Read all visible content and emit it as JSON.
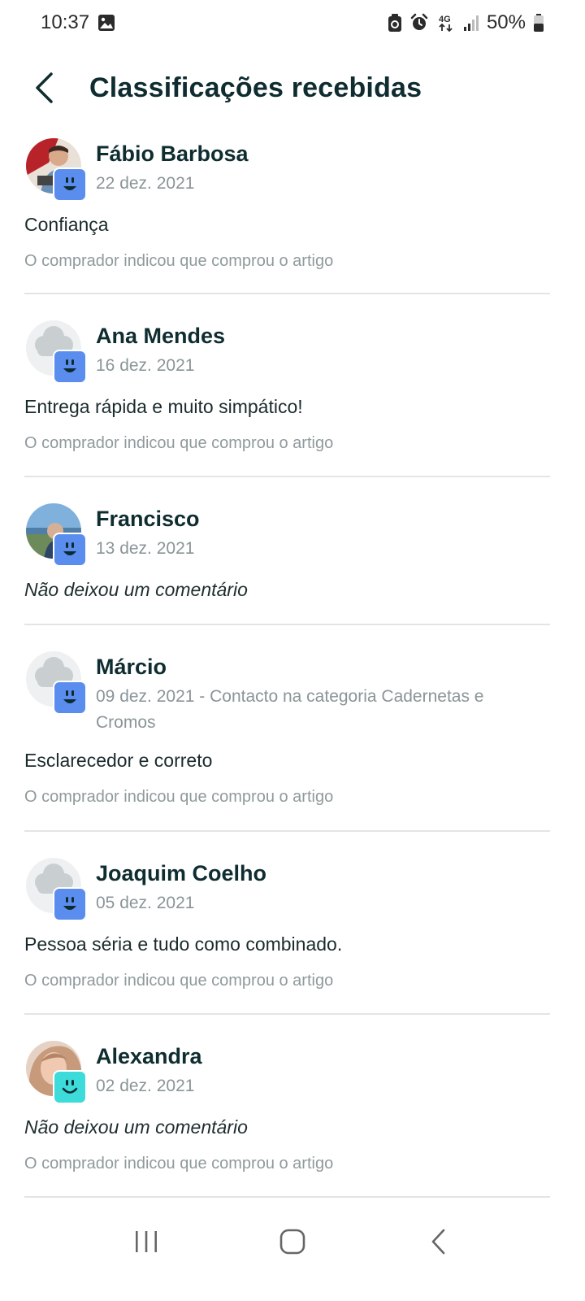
{
  "status_bar": {
    "time": "10:37",
    "battery": "50%",
    "network": "4G",
    "icons": [
      "gallery-icon",
      "recycle-icon",
      "alarm-icon",
      "4g-data-icon",
      "signal-icon",
      "battery-icon"
    ]
  },
  "header": {
    "title": "Classificações recebidas",
    "back_icon": "chevron-left-icon"
  },
  "colors": {
    "badge_blue": "#5b8def",
    "badge_teal": "#3ddbd9",
    "title": "#0f2d30",
    "muted": "#8a9598",
    "divider": "#e2e5e6"
  },
  "reviews": [
    {
      "name": "Fábio Barbosa",
      "date": "22 dez. 2021",
      "comment": "Confiança",
      "comment_italic": false,
      "note": "O comprador indicou que comprou o artigo",
      "avatar": "photo-red",
      "badge": "happy-face-icon",
      "badge_color": "#5b8def"
    },
    {
      "name": "Ana Mendes",
      "date": "16 dez. 2021",
      "comment": "Entrega rápida e muito simpático!",
      "comment_italic": false,
      "note": "O comprador indicou que comprou o artigo",
      "avatar": "default-cloud",
      "badge": "happy-face-icon",
      "badge_color": "#5b8def"
    },
    {
      "name": "Francisco",
      "date": "13 dez. 2021",
      "comment": "Não deixou um comentário",
      "comment_italic": true,
      "note": "",
      "avatar": "photo-coast",
      "badge": "happy-face-icon",
      "badge_color": "#5b8def"
    },
    {
      "name": "Márcio",
      "date": "09 dez. 2021 - Contacto na categoria Cadernetas e Cromos",
      "comment": "Esclarecedor e correto",
      "comment_italic": false,
      "note": "O comprador indicou que comprou o artigo",
      "avatar": "default-cloud",
      "badge": "happy-face-icon",
      "badge_color": "#5b8def"
    },
    {
      "name": "Joaquim Coelho",
      "date": "05 dez. 2021",
      "comment": "Pessoa séria e tudo como combinado.",
      "comment_italic": false,
      "note": "O comprador indicou que comprou o artigo",
      "avatar": "default-cloud",
      "badge": "happy-face-icon",
      "badge_color": "#5b8def"
    },
    {
      "name": "Alexandra",
      "date": "02 dez. 2021",
      "comment": "Não deixou um comentário",
      "comment_italic": true,
      "note": "O comprador indicou que comprou o artigo",
      "avatar": "photo-portrait",
      "badge": "smile-face-icon",
      "badge_color": "#3ddbd9"
    }
  ],
  "nav_bar": {
    "items": [
      "recent-apps-icon",
      "home-icon",
      "back-icon"
    ]
  }
}
